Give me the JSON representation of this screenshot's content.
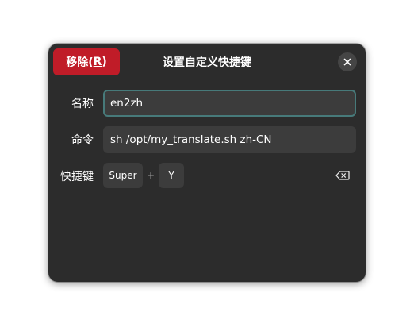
{
  "dialog": {
    "title": "设置自定义快捷键",
    "remove_button": {
      "label": "移除(",
      "mnemonic": "R",
      "label_end": ")"
    },
    "close_icon": "close-icon"
  },
  "fields": {
    "name": {
      "label": "名称",
      "value": "en2zh"
    },
    "command": {
      "label": "命令",
      "value": "sh /opt/my_translate.sh zh-CN"
    },
    "shortcut": {
      "label": "快捷键",
      "keys": [
        "Super",
        "Y"
      ],
      "separator": "+",
      "clear_icon": "backspace-icon"
    }
  },
  "colors": {
    "destructive": "#c01c28",
    "dialog_bg": "#2c2c2c",
    "entry_bg": "#3c3c3c",
    "focus_ring": "#477a7a"
  }
}
